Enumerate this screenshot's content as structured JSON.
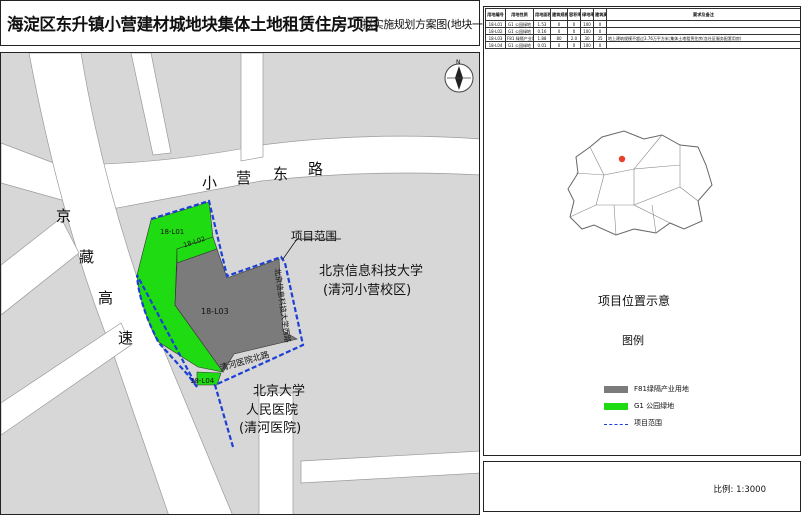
{
  "title": {
    "main": "海淀区东升镇小营建材城地块集体土地租赁住房项目",
    "sub": "拟实施规划方案图(地块一)"
  },
  "colors": {
    "green_space": "#1FDC12",
    "industry_land": "#7B7B7B",
    "boundary": "#1c3fd6",
    "road": "#FFFFFF",
    "background": "#D7D7D7"
  },
  "plan_table": {
    "headers": [
      "用地编号",
      "用地性质",
      "用地面积(公顷)",
      "建筑规模(㎡)",
      "容积率",
      "绿地率(%)",
      "建筑高度(m)",
      "要求及备注"
    ],
    "rows": [
      [
        "18-L01",
        "G1 公园绿地",
        "1.53",
        "0",
        "0",
        "100",
        "0",
        ""
      ],
      [
        "18-L02",
        "G1 公园绿地",
        "0.16",
        "0",
        "0",
        "100",
        "0",
        ""
      ],
      [
        "18-L03",
        "F81 绿隔产业用地",
        "1.88",
        "80",
        "2.0",
        "30",
        "35",
        "地上建筑规模不超过3.76万平方米;集体土地租赁住房(含社区服务配套用房)"
      ],
      [
        "18-L04",
        "G1 公园绿地",
        "0.01",
        "0",
        "0",
        "100",
        "0",
        ""
      ]
    ]
  },
  "location_title": "项目位置示意",
  "legend": {
    "title": "图例",
    "items": [
      {
        "label": "F81绿隔产业用地",
        "color": "#7B7B7B",
        "kind": "fill"
      },
      {
        "label": "G1  公园绿地",
        "color": "#1FDC12",
        "kind": "fill"
      },
      {
        "label": "项目范围",
        "color": "#1c3fd6",
        "kind": "dashed"
      }
    ]
  },
  "scale": "比例: 1:3000",
  "map": {
    "north_label": "N",
    "roads": {
      "xiaoying_dong_lu": [
        "小",
        "营",
        "东",
        "路"
      ],
      "jingzang_gaosu": [
        "京",
        "藏",
        "高",
        "速"
      ],
      "qinghe_yiyuan_bei_lu": "清河医院北路",
      "bkxx_xi_lu": "北京信息科技大学西路"
    },
    "parcels": {
      "L01": "18-L01",
      "L02": "18-L02",
      "L03": "18-L03",
      "L04": "18-L04"
    },
    "project_range": "项目范围",
    "bistu": [
      "北京信息科技大学",
      "(清河小营校区)"
    ],
    "hospital": [
      "北京大学",
      "人民医院",
      "(清河医院)"
    ]
  }
}
